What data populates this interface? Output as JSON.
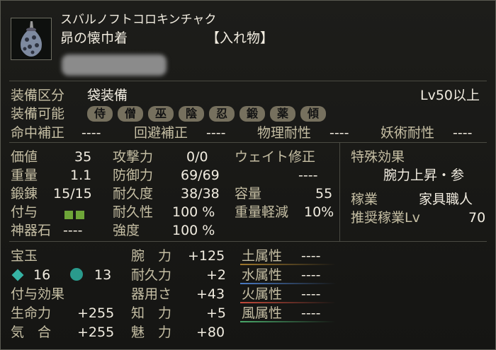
{
  "item": {
    "reading": "スバルノフトコロキンチャク",
    "name": "昴の懐巾着",
    "category": "【入れ物】"
  },
  "equip": {
    "division_label": "装備区分",
    "division_value": "袋装備",
    "level_req": "Lv50以上",
    "usable_label": "装備可能",
    "classes": [
      "侍",
      "僧",
      "巫",
      "陰",
      "忍",
      "鍛",
      "薬",
      "傾"
    ]
  },
  "corrections": [
    {
      "label": "命中補正",
      "value": "----"
    },
    {
      "label": "回避補正",
      "value": "----"
    },
    {
      "label": "物理耐性",
      "value": "----"
    },
    {
      "label": "妖術耐性",
      "value": "----"
    }
  ],
  "stats_left": [
    {
      "label": "価値",
      "value": "35"
    },
    {
      "label": "重量",
      "value": "1.1"
    },
    {
      "label": "鍛錬",
      "value": "15/15"
    },
    {
      "label": "付与",
      "value": ""
    },
    {
      "label": "神器石",
      "value": "----"
    }
  ],
  "stats_mid": [
    {
      "label": "攻撃力",
      "value": "0/0"
    },
    {
      "label": "防御力",
      "value": "69/69"
    },
    {
      "label": "耐久度",
      "value": "38/38"
    },
    {
      "label": "耐久性",
      "value": "100 %"
    },
    {
      "label": "強度",
      "value": "100 %"
    }
  ],
  "weight_correction": {
    "label": "ウェイト修正",
    "value": "----",
    "capacity_label": "容量",
    "capacity_value": "55",
    "reduce_label": "重量軽減",
    "reduce_value": "10%"
  },
  "special": {
    "title": "特殊効果",
    "effect": "腕力上昇・参",
    "job_label": "稼業",
    "job_value": "家具職人",
    "recjob_label": "推奨稼業Lv",
    "recjob_value": "70"
  },
  "gems": {
    "title": "宝玉",
    "count_a": "16",
    "count_b": "13",
    "enchant_title": "付与効果",
    "hp_label": "生命力",
    "hp_value": "+255",
    "ki_label": "気　合",
    "ki_value": "+255"
  },
  "attributes": [
    {
      "label": "腕　力",
      "value": "+125"
    },
    {
      "label": "耐久力",
      "value": "+2"
    },
    {
      "label": "器用さ",
      "value": "+43"
    },
    {
      "label": "知　力",
      "value": "+5"
    },
    {
      "label": "魅　力",
      "value": "+80"
    }
  ],
  "elements": [
    {
      "label": "土属性",
      "value": "----",
      "color": "#a0782c"
    },
    {
      "label": "水属性",
      "value": "----",
      "color": "#4a7ac4"
    },
    {
      "label": "火属性",
      "value": "----",
      "color": "#c44a3a"
    },
    {
      "label": "風属性",
      "value": "----",
      "color": "#4aa86a"
    }
  ]
}
